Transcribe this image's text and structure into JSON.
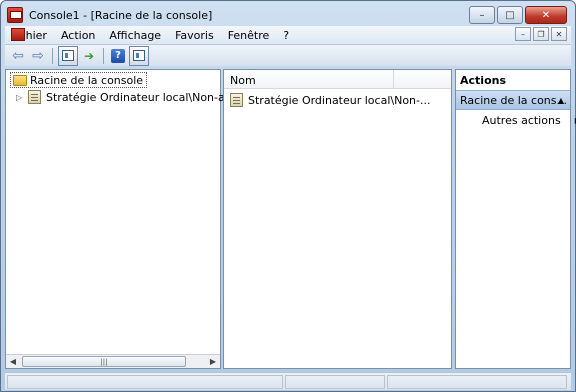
{
  "window": {
    "title": "Console1 - [Racine de la console]",
    "minimize_glyph": "–",
    "maximize_glyph": "□",
    "close_glyph": "✕"
  },
  "menu": {
    "items": [
      "Fichier",
      "Action",
      "Affichage",
      "Favoris",
      "Fenêtre",
      "?"
    ],
    "mdi_minimize": "–",
    "mdi_restore": "❐",
    "mdi_close": "✕"
  },
  "toolbar": {
    "back_glyph": "⇦",
    "forward_glyph": "⇨",
    "help_glyph": "?",
    "export_glyph": "➔"
  },
  "tree": {
    "root_label": "Racine de la console",
    "child_label": "Stratégie Ordinateur local\\Non-administ",
    "expander_glyph": "▷",
    "scroll_left": "◀",
    "scroll_right": "▶",
    "scroll_grip": "|||"
  },
  "list": {
    "column_name": "Nom",
    "rows": [
      "Stratégie Ordinateur local\\Non-..."
    ]
  },
  "actions": {
    "title": "Actions",
    "section_label": "Racine de la cons...",
    "collapse_glyph": "▲",
    "more_actions": "Autres actions",
    "submenu_glyph": "▶"
  },
  "colors": {
    "accent_section": "#a9c4e4",
    "window_frame": "#b2cbe6",
    "close_button": "#c0392b"
  },
  "icons": {
    "app": "mmc-console-icon",
    "folder": "folder-icon",
    "policy": "group-policy-icon"
  }
}
